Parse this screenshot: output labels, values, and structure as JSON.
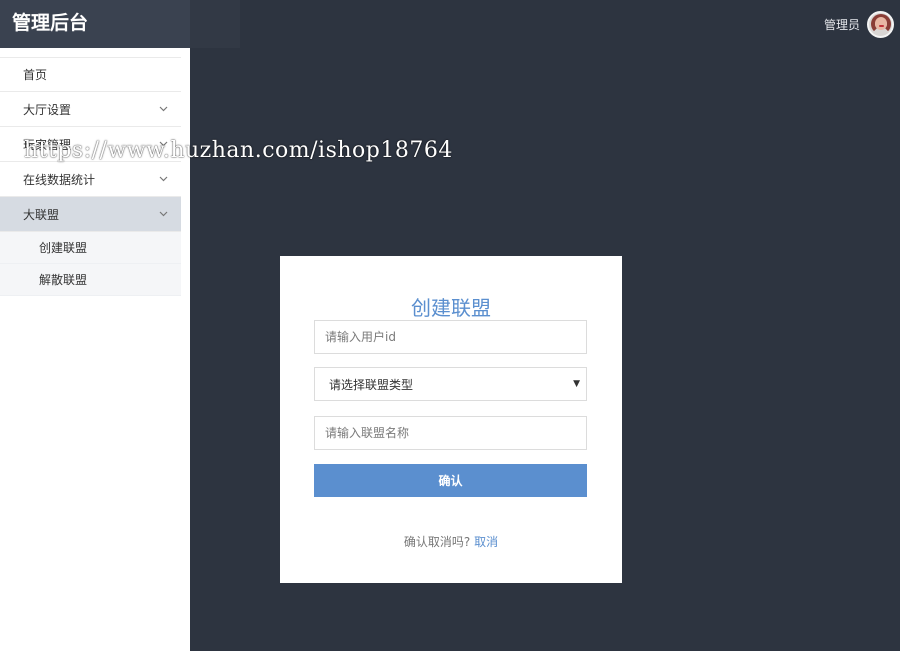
{
  "app": {
    "title": "管理后台"
  },
  "header": {
    "user_name": "管理员"
  },
  "sidebar": {
    "items": [
      {
        "label": "首页",
        "has_chevron": false
      },
      {
        "label": "大厅设置",
        "has_chevron": true
      },
      {
        "label": "玩家管理",
        "has_chevron": true
      },
      {
        "label": "在线数据统计",
        "has_chevron": true
      },
      {
        "label": "大联盟",
        "has_chevron": true,
        "active": true
      }
    ],
    "submenu": [
      {
        "label": "创建联盟"
      },
      {
        "label": "解散联盟"
      }
    ]
  },
  "watermark": {
    "text": "https://www.huzhan.com/ishop18764"
  },
  "form": {
    "title": "创建联盟",
    "user_id_placeholder": "请输入用户id",
    "type_select_value": "请选择联盟类型",
    "name_placeholder": "请输入联盟名称",
    "submit_label": "确认",
    "cancel_prompt": "确认取消吗?",
    "cancel_link": "取消"
  },
  "colors": {
    "background": "#2d3440",
    "accent": "#5b8fcf",
    "active_menu": "#d6dbe2"
  }
}
